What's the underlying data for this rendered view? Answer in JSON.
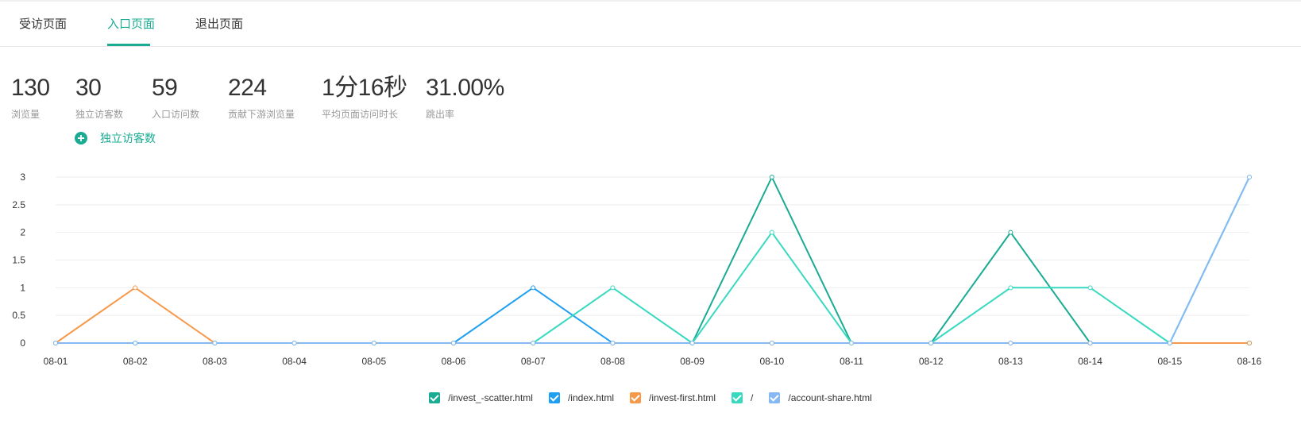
{
  "tabs": [
    {
      "label": "受访页面",
      "active": false
    },
    {
      "label": "入口页面",
      "active": true
    },
    {
      "label": "退出页面",
      "active": false
    }
  ],
  "stats": [
    {
      "value": "130",
      "label": "浏览量"
    },
    {
      "value": "30",
      "label": "独立访客数"
    },
    {
      "value": "59",
      "label": "入口访问数"
    },
    {
      "value": "224",
      "label": "贡献下游浏览量"
    },
    {
      "value": "1分16秒",
      "label": "平均页面访问时长"
    },
    {
      "value": "31.00%",
      "label": "跳出率"
    }
  ],
  "add_metric": {
    "label": "独立访客数"
  },
  "colors": {
    "accent": "#1aab93",
    "grid": "#eeeeee",
    "axis_text": "#333333"
  },
  "chart_data": {
    "type": "line",
    "x": [
      "08-01",
      "08-02",
      "08-03",
      "08-04",
      "08-05",
      "08-06",
      "08-07",
      "08-08",
      "08-09",
      "08-10",
      "08-11",
      "08-12",
      "08-13",
      "08-14",
      "08-15",
      "08-16"
    ],
    "ylim": [
      0,
      3
    ],
    "yticks": [
      "0",
      "0.5",
      "1",
      "1.5",
      "2",
      "2.5",
      "3"
    ],
    "grid": true,
    "legend_position": "bottom-center",
    "series": [
      {
        "name": "/invest_-scatter.html",
        "color": "#1aab93",
        "values": [
          0,
          0,
          0,
          0,
          0,
          0,
          0,
          0,
          0,
          3,
          0,
          0,
          2,
          0,
          0,
          0
        ]
      },
      {
        "name": "/index.html",
        "color": "#1e9ff2",
        "values": [
          0,
          0,
          0,
          0,
          0,
          0,
          1,
          0,
          0,
          0,
          0,
          0,
          0,
          0,
          0,
          0
        ]
      },
      {
        "name": "/invest-first.html",
        "color": "#f7994b",
        "values": [
          0,
          1,
          0,
          0,
          0,
          0,
          0,
          0,
          0,
          0,
          0,
          0,
          0,
          0,
          0,
          0
        ]
      },
      {
        "name": "/",
        "color": "#39d9c0",
        "values": [
          0,
          0,
          0,
          0,
          0,
          0,
          0,
          1,
          0,
          2,
          0,
          0,
          1,
          1,
          0,
          3
        ]
      },
      {
        "name": "/account-share.html",
        "color": "#86b8f4",
        "values": [
          0,
          0,
          0,
          0,
          0,
          0,
          0,
          0,
          0,
          0,
          0,
          0,
          0,
          0,
          0,
          3
        ]
      }
    ]
  }
}
